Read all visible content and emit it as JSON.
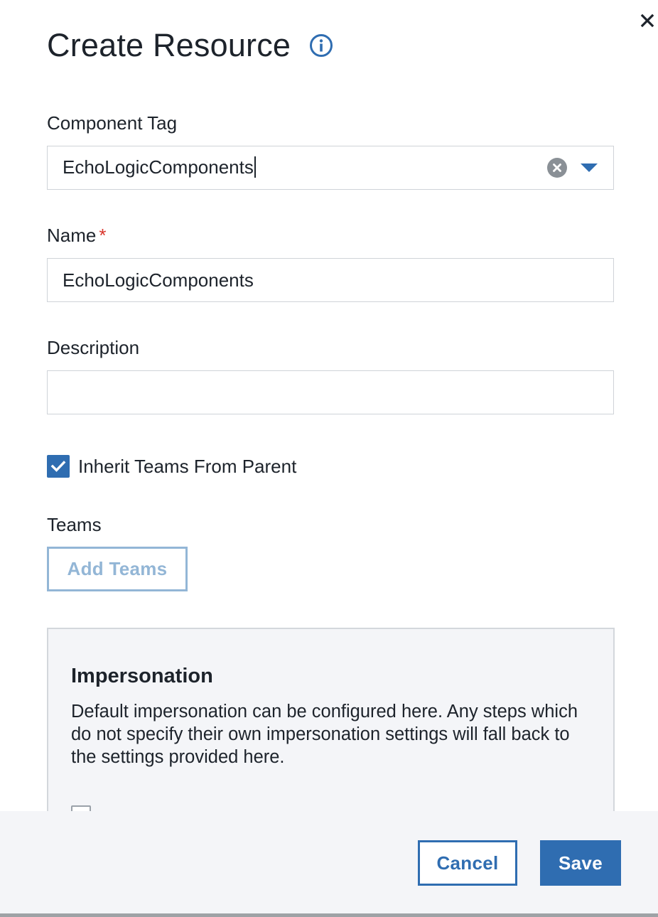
{
  "dialog": {
    "title": "Create Resource",
    "close_icon": "close-icon",
    "info_icon": "info-icon"
  },
  "form": {
    "component_tag": {
      "label": "Component Tag",
      "value": "EchoLogicComponents",
      "clear_icon": "clear-circle-icon",
      "dropdown_icon": "caret-down-icon"
    },
    "name": {
      "label": "Name",
      "required_mark": "*",
      "value": "EchoLogicComponents"
    },
    "description": {
      "label": "Description",
      "value": ""
    },
    "inherit_teams": {
      "label": "Inherit Teams From Parent",
      "checked": true
    },
    "teams": {
      "label": "Teams",
      "add_button": "Add Teams"
    }
  },
  "impersonation": {
    "title": "Impersonation",
    "description": "Default impersonation can be configured here. Any steps which do not specify their own impersonation settings will fall back to the settings provided here."
  },
  "footer": {
    "cancel_label": "Cancel",
    "save_label": "Save"
  },
  "colors": {
    "accent": "#2f6db1",
    "accent_disabled": "#93b6d6",
    "required": "#d9342b",
    "panel_bg": "#f4f5f8"
  }
}
